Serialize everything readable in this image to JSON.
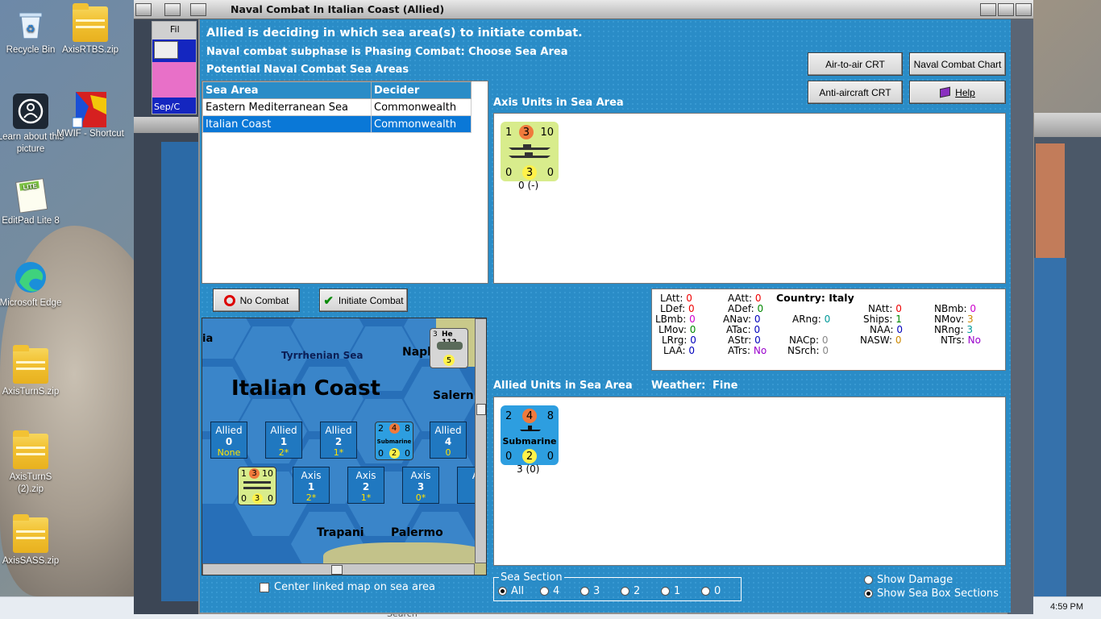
{
  "desktop": {
    "icons": [
      {
        "label": "Recycle Bin"
      },
      {
        "label": "AxisRTBS.zip"
      },
      {
        "label": "Learn about this picture"
      },
      {
        "label": "MWIF - Shortcut"
      },
      {
        "label": "EditPad Lite 8"
      },
      {
        "label": "Microsoft Edge"
      },
      {
        "label": "AxisTurnS.zip"
      },
      {
        "label": "AxisTurnS (2).zip"
      },
      {
        "label": "AxisSASS.zip"
      }
    ]
  },
  "taskbar": {
    "time": "4:59 PM",
    "search": "Search"
  },
  "window": {
    "title": "Naval Combat In Italian Coast (Allied)",
    "side_tab": "Fil",
    "date_fragment": "Sep/C"
  },
  "dialog": {
    "header1": "Allied is deciding in which sea area(s) to initiate combat.",
    "header2": "Naval combat subphase is Phasing Combat: Choose Sea Area",
    "header3": "Potential Naval Combat Sea Areas",
    "buttons": {
      "air_to_air": "Air-to-air CRT",
      "naval_chart": "Naval Combat Chart",
      "anti_aircraft": "Anti-aircraft CRT",
      "help": "Help",
      "no_combat": "No Combat",
      "initiate_combat": "Initiate Combat"
    },
    "sea_table": {
      "headers": [
        "Sea Area",
        "Decider"
      ],
      "rows": [
        {
          "area": "Eastern Mediterranean Sea",
          "decider": "Commonwealth"
        },
        {
          "area": "Italian Coast",
          "decider": "Commonwealth"
        }
      ]
    },
    "axis_label": "Axis Units in Sea Area",
    "axis_unit": {
      "tl": "1",
      "tc": "3",
      "tr": "10",
      "bl": "0",
      "bc": "3",
      "br": "0",
      "under": "0 (-)"
    },
    "allied_label": "Allied Units in Sea Area",
    "weather_label": "Weather:",
    "weather": "Fine",
    "allied_unit": {
      "tl": "2",
      "tc": "4",
      "tr": "8",
      "name": "Submarine",
      "bl": "0",
      "bc": "2",
      "br": "0",
      "under": "3 (0)"
    },
    "stats": {
      "country_label": "Country:",
      "country": "Italy",
      "LAtt": "0",
      "LDef": "0",
      "LBmb": "0",
      "LMov": "0",
      "LRrg": "0",
      "LAA": "0",
      "AAtt": "0",
      "ADef": "0",
      "ANav": "0",
      "ATac": "0",
      "AStr": "0",
      "ATrs": "No",
      "ARng": "0",
      "NACp": "0",
      "NSrch": "0",
      "NAtt": "0",
      "Ships": "1",
      "NAA": "0",
      "NASW": "0",
      "NBmb": "0",
      "NMov": "3",
      "NRng": "3",
      "NTrs": "No"
    },
    "map": {
      "sea_name": "Tyrrhenian Sea",
      "area_title": "Italian Coast",
      "town_napl": "Napl",
      "town_salern": "Salern",
      "town_trapani": "Trapani",
      "town_palermo": "Palermo",
      "edge_ia": "ia",
      "he112_label": "He 112",
      "he112_top": "3",
      "he112_val": "5",
      "allied_boxes": [
        {
          "side": "Allied",
          "num": "0",
          "val": "None"
        },
        {
          "side": "Allied",
          "num": "1",
          "val": "2*"
        },
        {
          "side": "Allied",
          "num": "2",
          "val": "1*"
        },
        {
          "side": "Allied",
          "num": "4",
          "val": "0"
        }
      ],
      "axis_boxes": [
        {
          "side": "Axis",
          "num": "1",
          "val": "2*"
        },
        {
          "side": "Axis",
          "num": "2",
          "val": "1*"
        },
        {
          "side": "Axis",
          "num": "3",
          "val": "0*"
        },
        {
          "side": "A",
          "num": "",
          "val": ""
        }
      ],
      "map_sub": {
        "tl": "2",
        "tc": "4",
        "tr": "8",
        "name": "Submarine",
        "bl": "0",
        "bc": "2",
        "br": "0"
      },
      "map_axis": {
        "tl": "1",
        "tc": "3",
        "tr": "10",
        "bl": "0",
        "bc": "3",
        "br": "0"
      }
    },
    "center_check": "Center linked map on sea area",
    "sea_section": {
      "legend": "Sea Section",
      "options": [
        "All",
        "4",
        "3",
        "2",
        "1",
        "0"
      ],
      "selected": "All"
    },
    "show_damage": "Show Damage",
    "show_sections": "Show Sea Box Sections"
  }
}
